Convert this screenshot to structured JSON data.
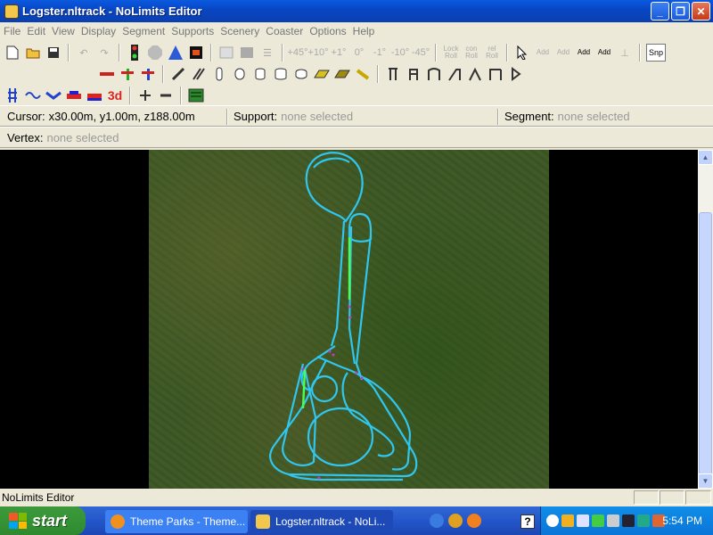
{
  "window": {
    "title": "Logster.nltrack - NoLimits Editor",
    "min": "_",
    "max": "❐",
    "close": "✕"
  },
  "menu": [
    "File",
    "Edit",
    "View",
    "Display",
    "Segment",
    "Supports",
    "Scenery",
    "Coaster",
    "Options",
    "Help"
  ],
  "toolbar1": {
    "angles": [
      "+45°",
      "+10°",
      "+1°",
      "0°",
      "-1°",
      "-10°",
      "-45°"
    ],
    "lock_roll": "Lock Roll",
    "con_roll": "con Roll",
    "rel_roll": "rel Roll",
    "snp": "Snp",
    "add_labels": [
      "Add",
      "Add",
      "Add",
      "Add"
    ]
  },
  "toolbar3": {
    "label_3d": "3d"
  },
  "status": {
    "cursor_label": "Cursor:",
    "cursor_value": "x30.00m, y1.00m, z188.00m",
    "support_label": "Support:",
    "support_value": "none selected",
    "segment_label": "Segment:",
    "segment_value": "none selected",
    "vertex_label": "Vertex:",
    "vertex_value": "none selected"
  },
  "app_status": "NoLimits Editor",
  "taskbar": {
    "start": "start",
    "tasks": [
      "Theme Parks - Theme...",
      "Logster.nltrack - NoLi..."
    ],
    "help": "?",
    "clock": "5:54 PM"
  },
  "colors": {
    "track": "#2fc6f0",
    "track_highlight": "#4cff4c",
    "support_marker": "#c03cc8"
  }
}
